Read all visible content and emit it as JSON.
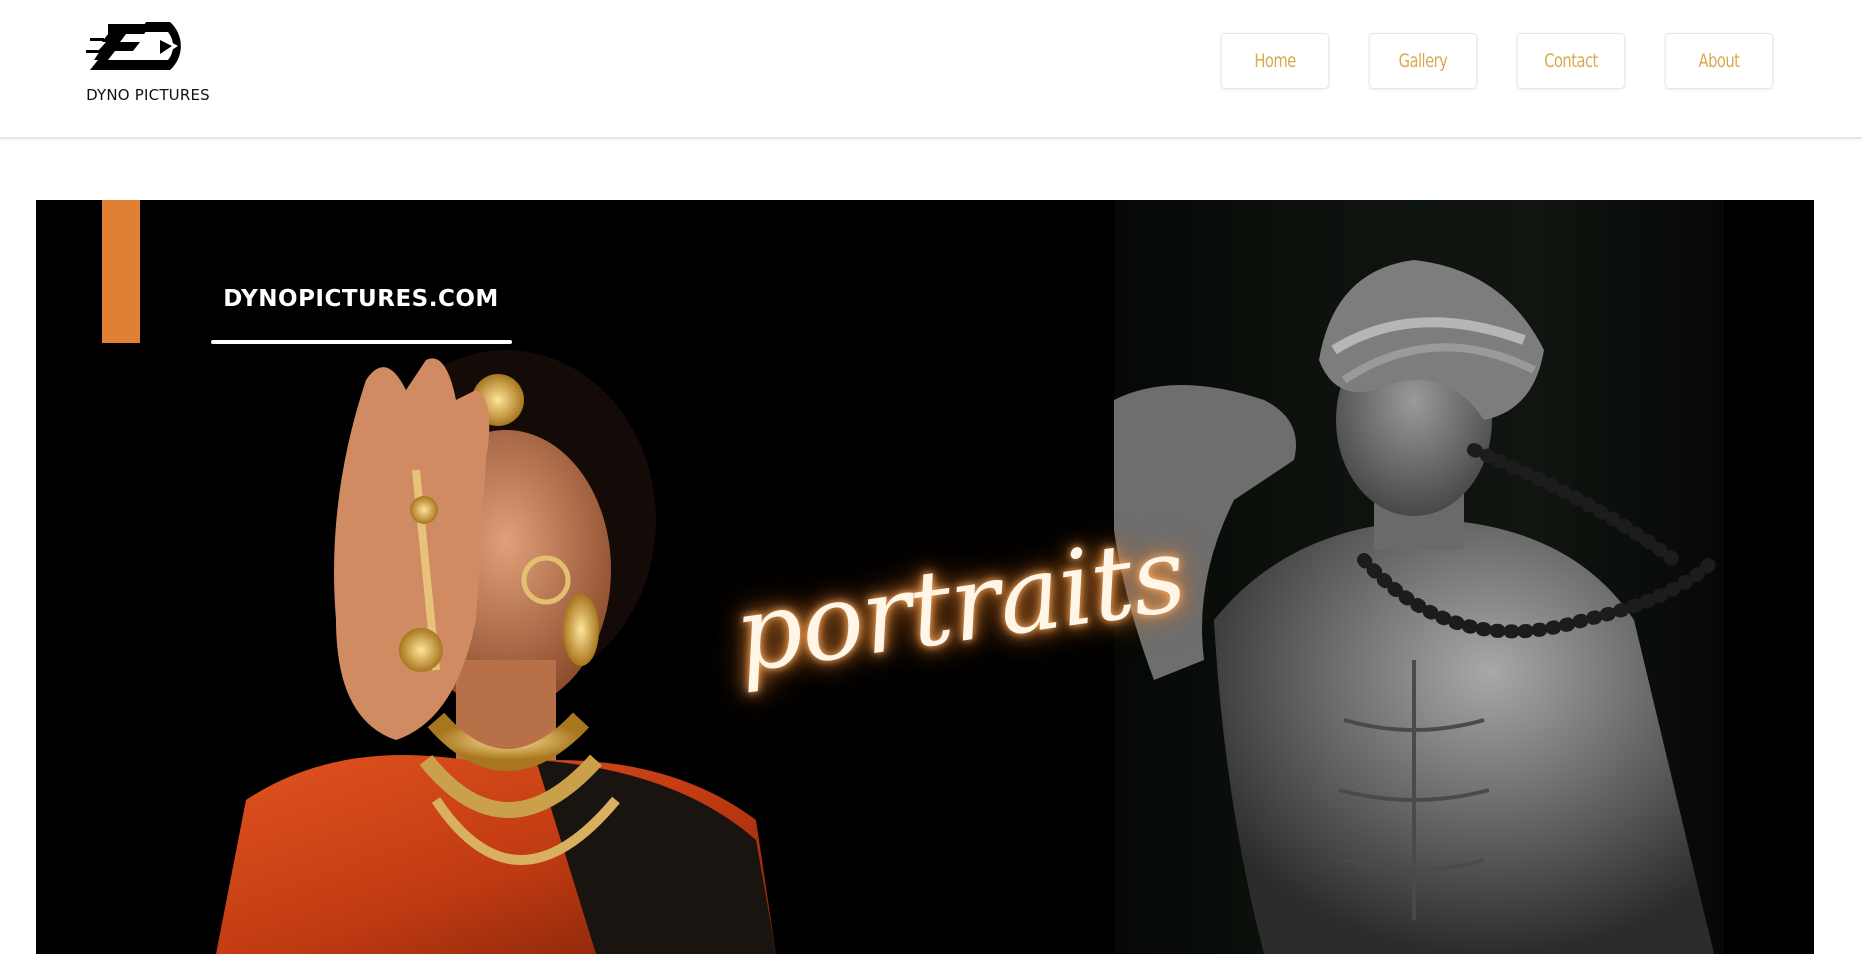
{
  "brand": {
    "name": "DYNO PICTURES",
    "logo_icon": "dyno-3d-logo-icon"
  },
  "nav": {
    "items": [
      {
        "label": "Home"
      },
      {
        "label": "Gallery"
      },
      {
        "label": "Contact"
      },
      {
        "label": "About"
      }
    ]
  },
  "hero": {
    "site_label": "DYNOPICTURES.COM",
    "script_title": "portraits",
    "left_photo": "bride-portrait-photo",
    "right_photo": "turban-man-portrait-photo"
  },
  "colors": {
    "accent": "#e08035",
    "nav_text": "#d9a84f",
    "hero_background": "#000000"
  }
}
